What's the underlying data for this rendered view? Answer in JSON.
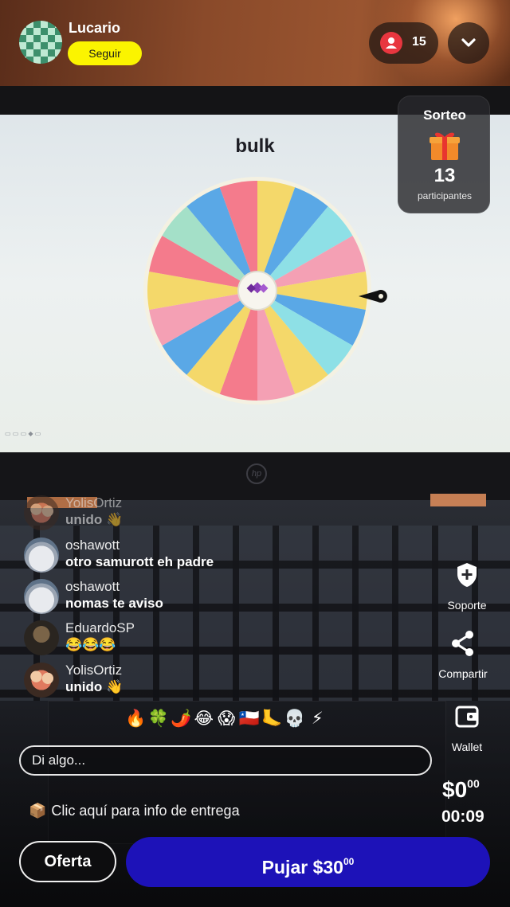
{
  "header": {
    "username": "Lucario",
    "follow_label": "Seguir",
    "viewer_count": "15"
  },
  "stream": {
    "wheel_title": "bulk",
    "laptop_brand": "hp",
    "wheel_colors": [
      "#5aa8e6",
      "#f4d86a",
      "#8ee0e6",
      "#f4a0b4",
      "#f47b8c",
      "#a4e0c8"
    ]
  },
  "giveaway": {
    "title": "Sorteo",
    "count": "13",
    "label": "participantes"
  },
  "chat": [
    {
      "user": "YolisOrtiz",
      "message": "unido 👋",
      "avatar": "yolis-avatar"
    },
    {
      "user": "oshawott",
      "message": "otro samurott eh padre",
      "avatar": "oshawott-avatar"
    },
    {
      "user": "oshawott",
      "message": "nomas te aviso",
      "avatar": "oshawott-avatar"
    },
    {
      "user": "EduardoSP",
      "message": "😂😂😂",
      "avatar": "eduardo-avatar"
    },
    {
      "user": "YolisOrtiz",
      "message": "unido 👋",
      "avatar": "yolis-avatar"
    }
  ],
  "reactions": [
    "🔥",
    "🍀",
    "🌶️",
    "😂",
    "😱",
    "🇨🇱",
    "🦶",
    "💀",
    "⚡"
  ],
  "input": {
    "placeholder": "Di algo..."
  },
  "delivery": {
    "icon": "📦",
    "text": "Clic aquí para info de entrega"
  },
  "side_actions": {
    "support": "Soporte",
    "share": "Compartir",
    "wallet": "Wallet"
  },
  "auction": {
    "price_main": "$0",
    "price_cents": "00",
    "timer": "00:09",
    "offer_label": "Oferta",
    "bid_main": "Pujar $30",
    "bid_cents": "00"
  },
  "colors": {
    "follow_yellow": "#fbf400",
    "bid_blue": "#1d12b8",
    "viewer_red": "#e8363f"
  }
}
